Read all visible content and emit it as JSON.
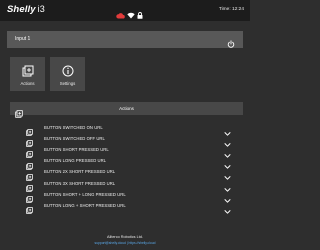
{
  "header": {
    "brand": "Shelly",
    "model": "i3",
    "time": "Time: 12:24",
    "status_icons": [
      "cloud-icon",
      "wifi-icon",
      "lock-icon"
    ],
    "cloud_color": "#e23b3b"
  },
  "input_panel": {
    "title": "Input 1",
    "icon": "power-icon"
  },
  "tiles": [
    {
      "label": "Actions",
      "icon": "actions-icon"
    },
    {
      "label": "Settings",
      "icon": "info-icon"
    }
  ],
  "actions_section": {
    "title": "Actions",
    "items": [
      {
        "label": "BUTTON SWITCHED ON URL"
      },
      {
        "label": "BUTTON SWITCHED OFF URL"
      },
      {
        "label": "BUTTON SHORT PRESSED URL"
      },
      {
        "label": "BUTTON LONG PRESSED URL"
      },
      {
        "label": "BUTTON 2X SHORT PRESSED URL"
      },
      {
        "label": "BUTTON 3X SHORT PRESSED URL"
      },
      {
        "label": "BUTTON SHORT + LONG PRESSED URL"
      },
      {
        "label": "BUTTON LONG + SHORT PRESSED URL"
      }
    ]
  },
  "footer": {
    "company": "Allterco Robotics Ltd.",
    "links": "support@shelly.cloud | https://shelly.cloud"
  },
  "colors": {
    "background": "#2e2e2e",
    "topbar": "#1c1c1c",
    "panel": "#585858",
    "tile": "#484848",
    "link": "#5aa8e8"
  }
}
